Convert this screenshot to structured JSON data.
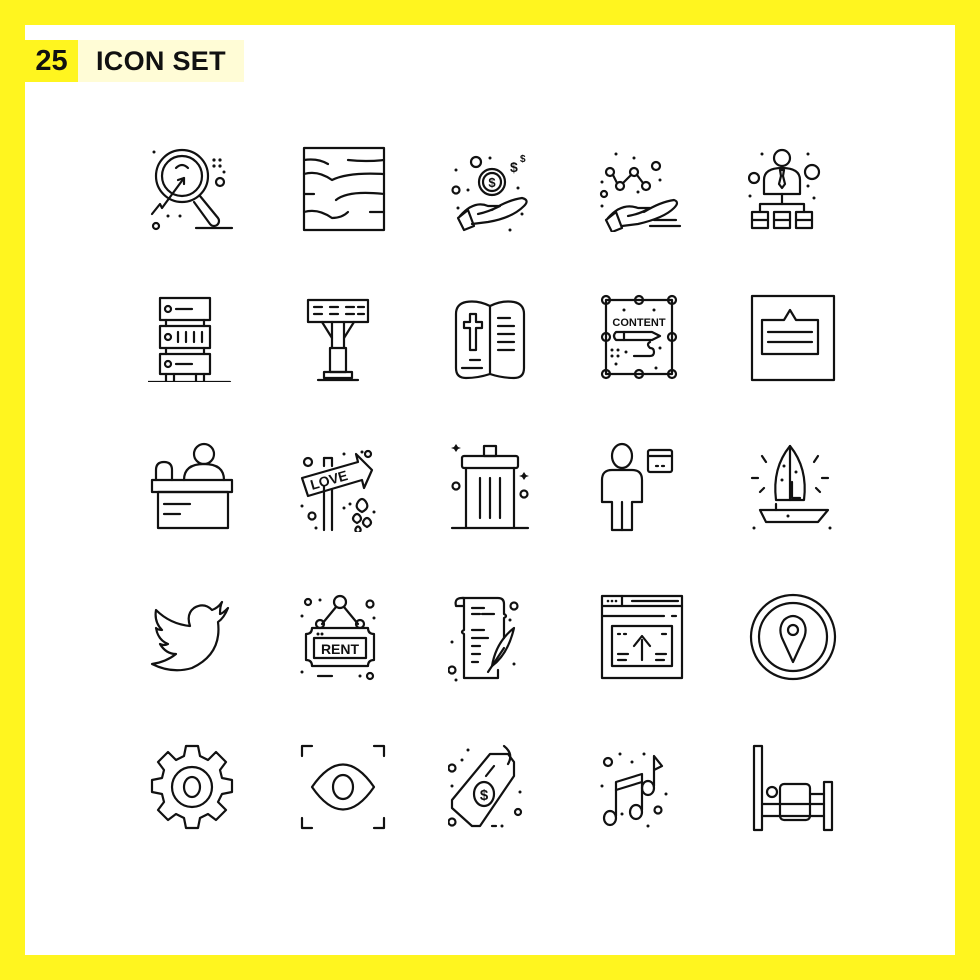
{
  "header": {
    "count": "25",
    "title": "ICON SET"
  },
  "colors": {
    "background": "#FFF51F",
    "panel": "#FFFFFF",
    "title_bg": "#FFFCD6",
    "icon_stroke": "#111111"
  },
  "icons": [
    {
      "name": "search-analytics-icon"
    },
    {
      "name": "water-texture-icon"
    },
    {
      "name": "hand-money-icon"
    },
    {
      "name": "hand-graph-icon"
    },
    {
      "name": "organization-hierarchy-icon"
    },
    {
      "name": "server-rack-icon"
    },
    {
      "name": "billboard-sign-icon"
    },
    {
      "name": "bible-book-icon"
    },
    {
      "name": "content-design-icon",
      "label": "CONTENT"
    },
    {
      "name": "notification-card-icon"
    },
    {
      "name": "reception-desk-icon"
    },
    {
      "name": "love-signpost-icon",
      "label": "LOVE"
    },
    {
      "name": "trash-bin-icon"
    },
    {
      "name": "user-card-icon"
    },
    {
      "name": "boat-sail-icon"
    },
    {
      "name": "twitter-bird-icon"
    },
    {
      "name": "rent-sign-icon",
      "label": "RENT"
    },
    {
      "name": "scroll-quill-icon"
    },
    {
      "name": "browser-upload-icon"
    },
    {
      "name": "location-pin-icon"
    },
    {
      "name": "gear-icon"
    },
    {
      "name": "eye-scan-icon"
    },
    {
      "name": "price-tag-icon",
      "label": "$"
    },
    {
      "name": "music-notes-icon"
    },
    {
      "name": "bed-icon"
    }
  ]
}
